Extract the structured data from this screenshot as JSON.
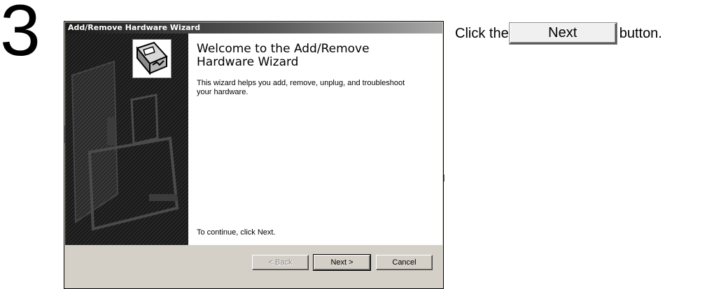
{
  "step": {
    "number": "3"
  },
  "wizard": {
    "title": "Add/Remove Hardware Wizard",
    "heading": "Welcome to the Add/Remove Hardware Wizard",
    "description": "This wizard helps you add, remove, unplug, and troubleshoot your hardware.",
    "continue_text": "To continue, click Next.",
    "buttons": {
      "back": "< Back",
      "next": "Next >",
      "cancel": "Cancel"
    },
    "icons": {
      "wizard_icon": "hardware-card-icon",
      "side_art": "hardware-illustration"
    }
  },
  "instruction": {
    "before": "Click the",
    "button_label": "Next",
    "after": "button."
  }
}
